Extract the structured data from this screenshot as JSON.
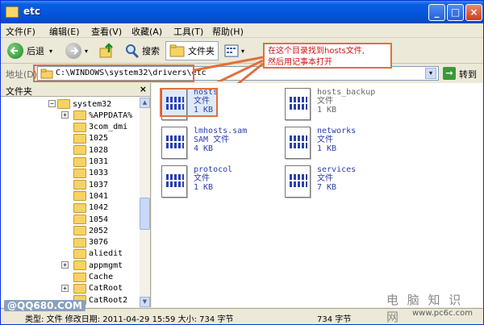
{
  "window": {
    "title": "etc"
  },
  "menu": [
    "文件(F)",
    "编辑(E)",
    "查看(V)",
    "收藏(A)",
    "工具(T)",
    "帮助(H)"
  ],
  "toolbar": {
    "back": "后退",
    "search": "搜索",
    "folders": "文件夹"
  },
  "address": {
    "label": "地址(D)",
    "path": "C:\\WINDOWS\\system32\\drivers\\etc",
    "go": "转到"
  },
  "callout": {
    "line1": "在这个目录找到hosts文件,",
    "line2": "然后用记事本打开"
  },
  "left_pane": {
    "title": "文件夹",
    "close": "×"
  },
  "tree": [
    {
      "label": "system32",
      "expander": "−",
      "level": 0
    },
    {
      "label": "%APPDATA%",
      "expander": "+",
      "level": 1
    },
    {
      "label": "3com_dmi",
      "expander": "",
      "level": 1
    },
    {
      "label": "1025",
      "expander": "",
      "level": 1
    },
    {
      "label": "1028",
      "expander": "",
      "level": 1
    },
    {
      "label": "1031",
      "expander": "",
      "level": 1
    },
    {
      "label": "1033",
      "expander": "",
      "level": 1
    },
    {
      "label": "1037",
      "expander": "",
      "level": 1
    },
    {
      "label": "1041",
      "expander": "",
      "level": 1
    },
    {
      "label": "1042",
      "expander": "",
      "level": 1
    },
    {
      "label": "1054",
      "expander": "",
      "level": 1
    },
    {
      "label": "2052",
      "expander": "",
      "level": 1
    },
    {
      "label": "3076",
      "expander": "",
      "level": 1
    },
    {
      "label": "aliedit",
      "expander": "",
      "level": 1
    },
    {
      "label": "appmgmt",
      "expander": "+",
      "level": 1
    },
    {
      "label": "Cache",
      "expander": "",
      "level": 1
    },
    {
      "label": "CatRoot",
      "expander": "+",
      "level": 1
    },
    {
      "label": "CatRoot2",
      "expander": "",
      "level": 1
    }
  ],
  "files": [
    {
      "name": "hosts",
      "type": "文件",
      "size": "1 KB"
    },
    {
      "name": "hosts_backup",
      "type": "文件",
      "size": "1 KB"
    },
    {
      "name": "lmhosts.sam",
      "type": "SAM 文件",
      "size": "4 KB"
    },
    {
      "name": "networks",
      "type": "文件",
      "size": "1 KB"
    },
    {
      "name": "protocol",
      "type": "文件",
      "size": "1 KB"
    },
    {
      "name": "services",
      "type": "文件",
      "size": "7 KB"
    }
  ],
  "status": {
    "left": "类型: 文件 修改日期: 2011-04-29 15:59 大小: 734 字节",
    "right": "734 字节"
  },
  "watermark": {
    "site_cn": "电 脑 知 识 网",
    "site_url": "www.pc6c.com",
    "logo": "@QQ680.COM"
  }
}
